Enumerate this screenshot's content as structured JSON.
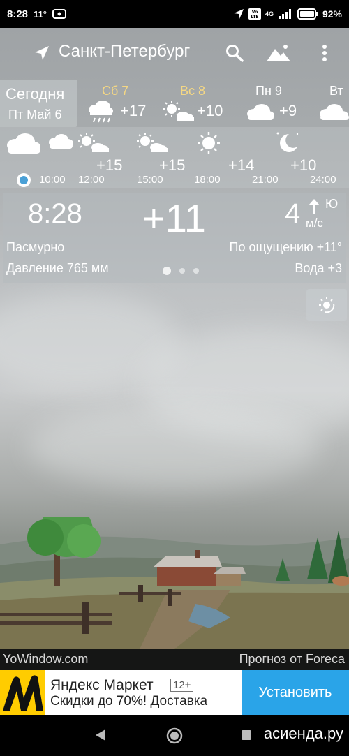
{
  "status_bar": {
    "time": "8:28",
    "temp": "11°",
    "battery": "92%",
    "network": "4G"
  },
  "header": {
    "city": "Санкт-Петербург"
  },
  "daily": {
    "today_title": "Сегодня",
    "today_date": "Пт Май 6",
    "days": [
      {
        "label": "Сб 7",
        "temp": "+17",
        "icon": "rain-cloud-icon"
      },
      {
        "label": "Вс 8",
        "temp": "+10",
        "icon": "sun-cloud-icon"
      },
      {
        "label": "Пн 9",
        "temp": "+9",
        "icon": "cloud-icon"
      },
      {
        "label": "Вт",
        "temp": "",
        "icon": "cloud-icon"
      }
    ]
  },
  "hourly": {
    "temps": [
      "+15",
      "+15",
      "+14",
      "+10"
    ],
    "times": [
      "10:00",
      "12:00",
      "15:00",
      "18:00",
      "21:00",
      "24:00"
    ]
  },
  "current": {
    "time": "8:28",
    "temp": "+11",
    "wind_speed": "4",
    "wind_dir": "Ю",
    "wind_unit": "м/с",
    "condition": "Пасмурно",
    "feels_like": "По ощущению +11°",
    "pressure": "Давление 765 мм",
    "water": "Вода +3"
  },
  "footer": {
    "brand": "YoWindow.com",
    "provider": "Прогноз от Foreca"
  },
  "ad": {
    "title": "Яндекс Маркет",
    "age": "12+",
    "subtitle": "Скидки до 70%! Доставка",
    "button": "Установить"
  },
  "watermark": "асиенда.ру",
  "colors": {
    "weekend": "#f4d784",
    "accent_blue": "#2aa4e8"
  }
}
